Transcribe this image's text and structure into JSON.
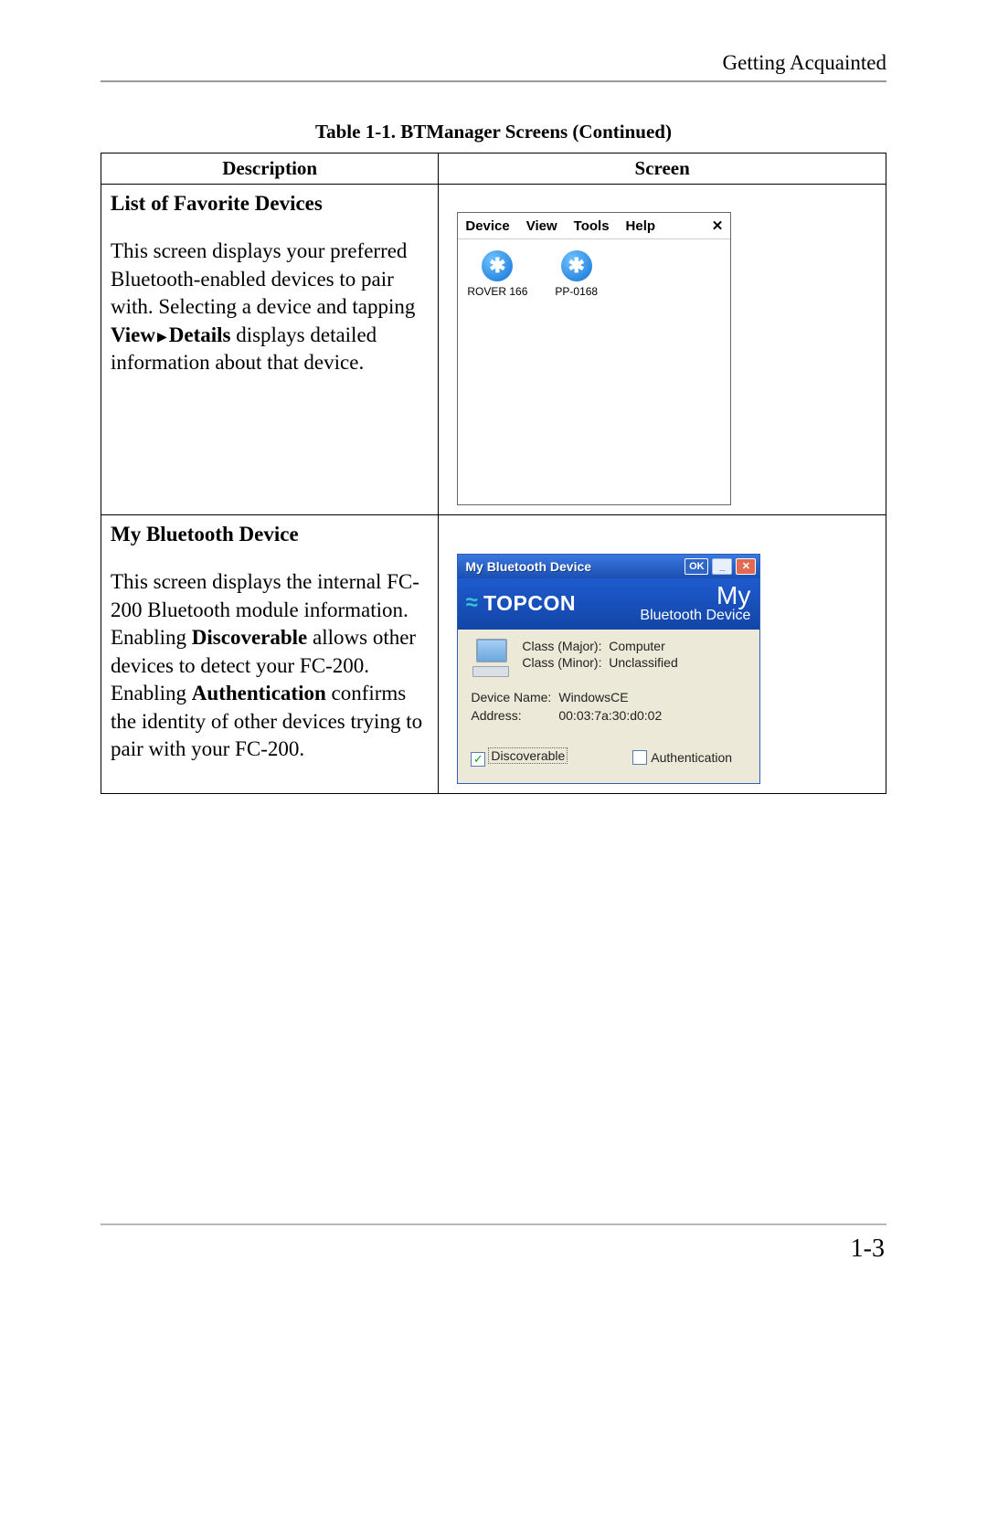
{
  "header": {
    "running_head": "Getting Acquainted"
  },
  "caption": "Table 1-1. BTManager Screens (Continued)",
  "columns": {
    "description": "Description",
    "screen": "Screen"
  },
  "row1": {
    "title": "List of Favorite Devices",
    "desc": {
      "p1": "This screen displays your preferred Bluetooth-enabled devices to pair with. Selecting a device and tapping ",
      "view": "View",
      "arrow": "▶",
      "details": "Details",
      "p2": " displays detailed information about that device."
    },
    "screen": {
      "menu": {
        "device": "Device",
        "view": "View",
        "tools": "Tools",
        "help": "Help",
        "close": "✕"
      },
      "items": [
        {
          "icon": "✱",
          "label": "ROVER 166"
        },
        {
          "icon": "✱",
          "label": "PP-0168"
        }
      ]
    }
  },
  "row2": {
    "title": "My Bluetooth Device",
    "desc": {
      "p1": "This screen displays the internal FC-200 Bluetooth module information. Enabling ",
      "discoverable": "Discoverable",
      "p2": " allows other devices to detect your FC-200. Enabling ",
      "authentication": "Authentication",
      "p3": " confirms the identity of other devices trying to pair with your FC-200."
    },
    "screen": {
      "titlebar": {
        "title": "My Bluetooth Device",
        "ok": "OK",
        "min": "_",
        "close": "✕"
      },
      "brand": "TOPCON",
      "banner": {
        "line1": "My",
        "line2": "Bluetooth Device"
      },
      "class": {
        "major_label": "Class (Major):",
        "major_value": "Computer",
        "minor_label": "Class (Minor):",
        "minor_value": "Unclassified"
      },
      "props": {
        "name_label": "Device Name:",
        "name_value": "WindowsCE",
        "addr_label": "Address:",
        "addr_value": "00:03:7a:30:d0:02"
      },
      "checkboxes": {
        "discoverable": {
          "label": "Discoverable",
          "checked": true,
          "tick": "✓"
        },
        "authentication": {
          "label": "Authentication",
          "checked": false
        }
      }
    }
  },
  "page_number": "1-3"
}
